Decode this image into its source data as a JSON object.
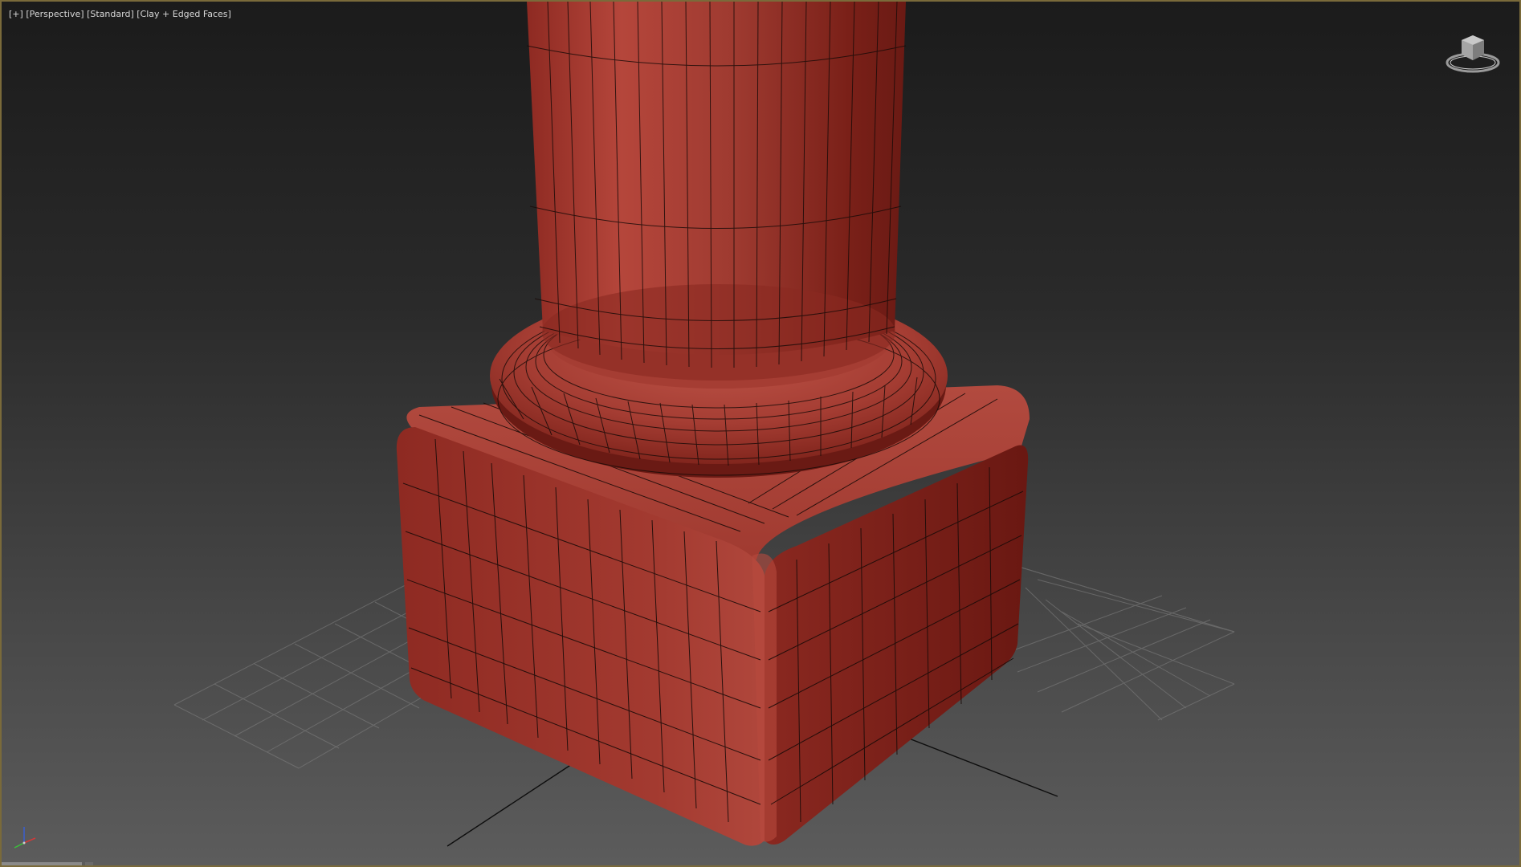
{
  "viewport": {
    "labels": {
      "plus": "[+]",
      "view": "[Perspective]",
      "shading_standard": "[Standard]",
      "shading_mode": "[Clay + Edged Faces]"
    },
    "frame_color": "#7a6a3a",
    "model_color": "#a8352c",
    "edge_color": "#1a0b08",
    "grid_color": "#7e7e7e"
  },
  "icons": {
    "viewcube": "viewcube-icon",
    "axis": "axis-tripod-icon"
  }
}
